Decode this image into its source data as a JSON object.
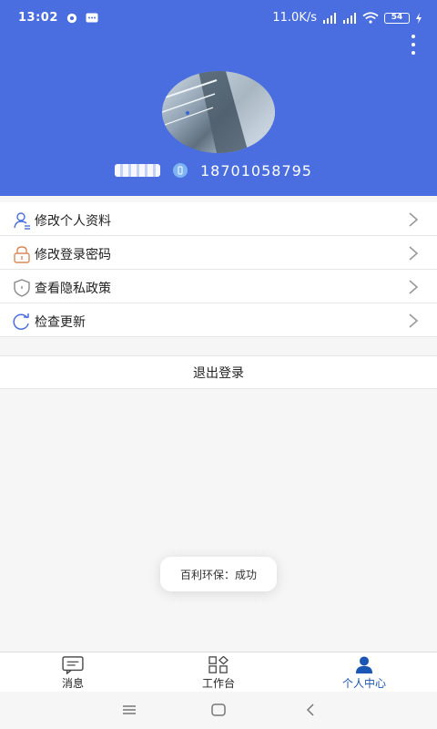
{
  "status_bar": {
    "time": "13:02",
    "network_speed": "11.0K/s",
    "battery_level": "54"
  },
  "profile": {
    "phone": "18701058795"
  },
  "menu": {
    "items": [
      {
        "label": "修改个人资料",
        "icon": "user-edit-icon"
      },
      {
        "label": "修改登录密码",
        "icon": "lock-icon"
      },
      {
        "label": "查看隐私政策",
        "icon": "shield-icon"
      },
      {
        "label": "检查更新",
        "icon": "refresh-icon"
      }
    ]
  },
  "logout_label": "退出登录",
  "toast": {
    "text": "百利环保：成功"
  },
  "tabbar": {
    "tabs": [
      {
        "label": "消息",
        "icon": "message-icon",
        "active": false
      },
      {
        "label": "工作台",
        "icon": "grid-icon",
        "active": false
      },
      {
        "label": "个人中心",
        "icon": "person-icon",
        "active": true
      }
    ]
  },
  "colors": {
    "header_bg": "#4a6ee0",
    "active_tab": "#1a56b4",
    "menu_icon": "#4a6ee0"
  }
}
